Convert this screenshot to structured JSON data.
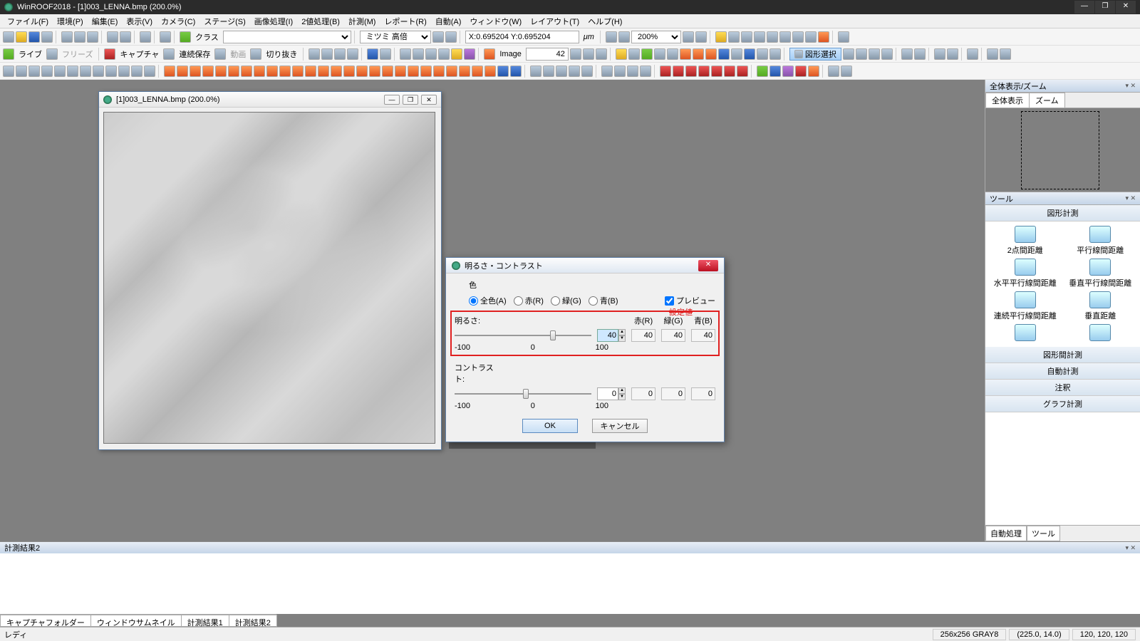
{
  "title": "WinROOF2018 - [1]003_LENNA.bmp (200.0%)",
  "menu": [
    "ファイル(F)",
    "環境(P)",
    "編集(E)",
    "表示(V)",
    "カメラ(C)",
    "ステージ(S)",
    "画像処理(I)",
    "2値処理(B)",
    "計測(M)",
    "レポート(R)",
    "自動(A)",
    "ウィンドウ(W)",
    "レイアウト(T)",
    "ヘルプ(H)"
  ],
  "toolbar": {
    "classLabel": "クラス",
    "mitsumi": "ミツミ 高倍",
    "coord": "X:0.695204 Y:0.695204",
    "unit": "μm",
    "zoom": "200%",
    "live": "ライブ",
    "freeze": "フリーズ",
    "capture": "キャプチャ",
    "contSave": "連続保存",
    "movie": "動画",
    "crop": "切り抜き",
    "imageLabel": "Image",
    "imageVal": "42",
    "shapeSel": "図形選択"
  },
  "imgwin": {
    "caption": "[1]003_LENNA.bmp (200.0%)"
  },
  "dialog": {
    "title": "明るさ・コントラスト",
    "color": "色",
    "all": "全色(A)",
    "red": "赤(R)",
    "green": "緑(G)",
    "blue": "青(B)",
    "preview": "プレビュー",
    "setLabel": "設定値",
    "brightness": "明るさ:",
    "contrast": "コントラスト:",
    "hR": "赤(R)",
    "hG": "緑(G)",
    "hB": "青(B)",
    "bVal": "40",
    "bR": "40",
    "bG": "40",
    "bB": "40",
    "cVal": "0",
    "cR": "0",
    "cG": "0",
    "cB": "0",
    "min": "-100",
    "mid": "0",
    "max": "100",
    "ok": "OK",
    "cancel": "キャンセル"
  },
  "right": {
    "p1": "全体表示/ズーム",
    "t1a": "全体表示",
    "t1b": "ズーム",
    "p2": "ツール",
    "head1": "図形計測",
    "tools": [
      "2点間距離",
      "平行線間距離",
      "水平平行線間距離",
      "垂直平行線間距離",
      "連続平行線間距離",
      "垂直距離"
    ],
    "heads": [
      "図形間計測",
      "自動計測",
      "注釈",
      "グラフ計測"
    ],
    "bt1": "自動処理",
    "bt2": "ツール"
  },
  "results": {
    "title": "計測結果2"
  },
  "bottomTabs": [
    "キャプチャフォルダー",
    "ウィンドウサムネイル",
    "計測結果1",
    "計測結果2"
  ],
  "status": {
    "ready": "レディ",
    "dim": "256x256 GRAY8",
    "pos": "(225.0, 14.0)",
    "rgb": "120, 120, 120"
  }
}
